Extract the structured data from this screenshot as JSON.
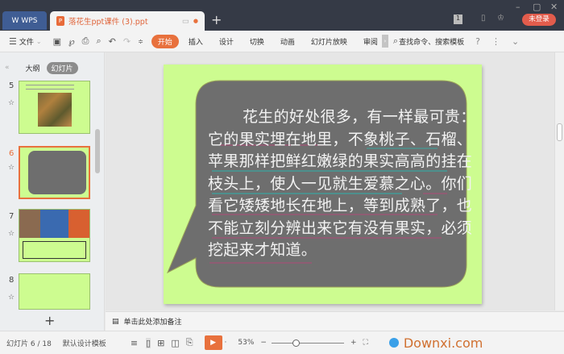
{
  "titlebar": {
    "app": "WPS",
    "doc_tab": "落花生ppt课件 (3).ppt",
    "new_tab": "+",
    "badge": "1",
    "login": "未登录"
  },
  "toolbar": {
    "file": "文件",
    "tabs": [
      "开始",
      "插入",
      "设计",
      "切换",
      "动画",
      "幻灯片放映",
      "审阅"
    ],
    "search": "查找命令、搜索模板",
    "help": "?"
  },
  "left_panel": {
    "tab_outline": "大纲",
    "tab_slides": "幻灯片",
    "slides": [
      {
        "num": "5"
      },
      {
        "num": "6",
        "selected": true
      },
      {
        "num": "7"
      },
      {
        "num": "8"
      }
    ],
    "add": "+"
  },
  "slide": {
    "lines": [
      "花生的好处很多，有一样最可贵：",
      "它的果实埋在地里，不象桃子、石榴、",
      "苹果那样把鲜红嫩绿的果实高高的挂在",
      "枝头上，使人一见就生爱慕之心。你们",
      "看它矮矮地长在地上，等到成熟了，也",
      "不能立刻分辨出来它有没有果实，必须",
      "挖起来才知道。"
    ],
    "bg": "#cdfc90",
    "bubble": "#6e6e6e"
  },
  "notes": {
    "placeholder": "单击此处添加备注"
  },
  "status": {
    "slide_counter": "幻灯片 6 / 18",
    "template": "默认设计模板",
    "zoom": "53%",
    "minus": "−",
    "plus": "+",
    "watermark": "Downxi.com"
  }
}
